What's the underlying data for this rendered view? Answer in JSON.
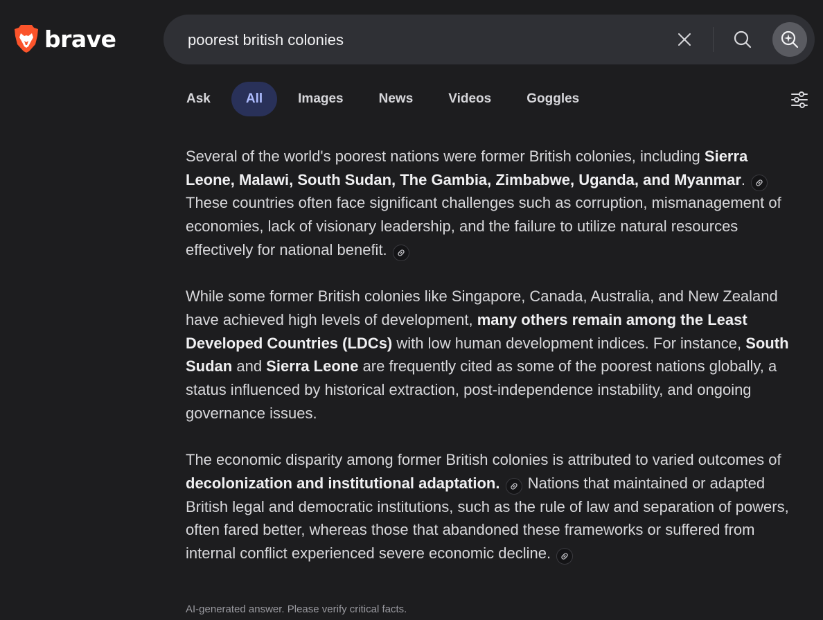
{
  "brand": {
    "name": "brave",
    "accent": "#fb542b"
  },
  "search": {
    "query": "poorest british colonies"
  },
  "tabs": [
    {
      "label": "Ask",
      "active": false
    },
    {
      "label": "All",
      "active": true
    },
    {
      "label": "Images",
      "active": false
    },
    {
      "label": "News",
      "active": false
    },
    {
      "label": "Videos",
      "active": false
    },
    {
      "label": "Goggles",
      "active": false
    }
  ],
  "answer": {
    "p1": {
      "t1": "Several of the world's poorest nations were former British colonies, including ",
      "b1": "Sierra Leone, Malawi, South Sudan, The Gambia, Zimbabwe, Uganda, and Myanmar",
      "t2": ". ",
      "t3": " These countries often face significant challenges such as corruption, mismanagement of economies, lack of visionary leadership, and the failure to utilize natural resources effectively for national benefit. "
    },
    "p2": {
      "t1": "While some former British colonies like Singapore, Canada, Australia, and New Zealand have achieved high levels of development, ",
      "b1": "many others remain among the Least Developed Countries (LDCs)",
      "t2": " with low human development indices. For instance, ",
      "b2": "South Sudan",
      "t3": " and ",
      "b3": "Sierra Leone",
      "t4": " are frequently cited as some of the poorest nations globally, a status influenced by historical extraction, post-independence instability, and ongoing governance issues."
    },
    "p3": {
      "t1": "The economic disparity among former British colonies is attributed to varied outcomes of ",
      "b1": "decolonization and institutional adaptation.",
      "t2": " ",
      "t3": " Nations that maintained or adapted British legal and democratic institutions, such as the rule of law and separation of powers, often fared better, whereas those that abandoned these frameworks or suffered from internal conflict experienced severe economic decline. "
    },
    "disclaimer": "AI-generated answer. Please verify critical facts."
  },
  "icons": {
    "logo": "brave-lion-icon",
    "clear": "close-icon",
    "search": "search-icon",
    "ai": "ai-sparkle-search-icon",
    "filter": "sliders-icon",
    "citation": "link-icon"
  }
}
